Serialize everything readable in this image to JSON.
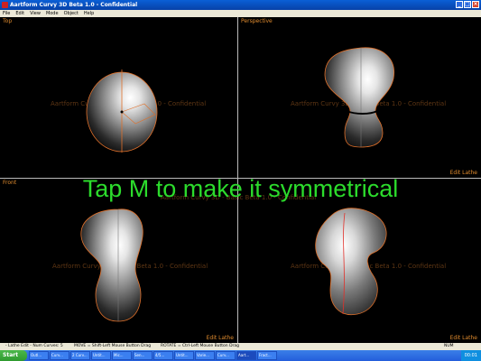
{
  "window": {
    "title": "Aartform Curvy 3D Beta 1.0 - Confidential",
    "buttons": [
      "_",
      "□",
      "×"
    ]
  },
  "menu": [
    "File",
    "Edit",
    "View",
    "Mode",
    "Object",
    "Help"
  ],
  "viewports": {
    "top": {
      "label": "Top",
      "watermark": "Aartform Curvy 3D - Basic Beta 1.0 - Confidential"
    },
    "perspective": {
      "label": "Perspective",
      "mode": "Edit Lathe",
      "watermark": "Aartform Curvy 3D - Basic Beta 1.0 - Confidential"
    },
    "front": {
      "label": "Front",
      "mode": "Edit Lathe",
      "watermark": "Aartform Curvy 3D - Basic Beta 1.0 - Confidential"
    },
    "side": {
      "mode": "Edit Lathe",
      "watermark": "Aartform Curvy 3D - Basic Beta 1.0 - Confidential"
    },
    "center_watermark": "Aartform Curvy 3D - Basic Beta 1.0 - Confidential"
  },
  "overlay_caption": "Tap M to make it symmetrical",
  "status": {
    "mode": "- Lathe Edit - Num Curves: 5",
    "move": "MOVE = Shift-Left Mouse Button Drag",
    "rotate": "ROTATE = Ctrl-Left Mouse Button Drag",
    "num": "NUM"
  },
  "taskbar": {
    "start": "Start",
    "tasks": [
      "Outl...",
      "Curv...",
      "2 Curv...",
      "Untit...",
      "Mic...",
      "Sen...",
      "4/5...",
      "Untit...",
      "Varie...",
      "Curv...",
      "Aart...",
      "Fract..."
    ],
    "clock": "00:01"
  },
  "colors": {
    "label": "#e08b2e",
    "caption": "#2cdc2c",
    "outline": "#e0702a"
  }
}
